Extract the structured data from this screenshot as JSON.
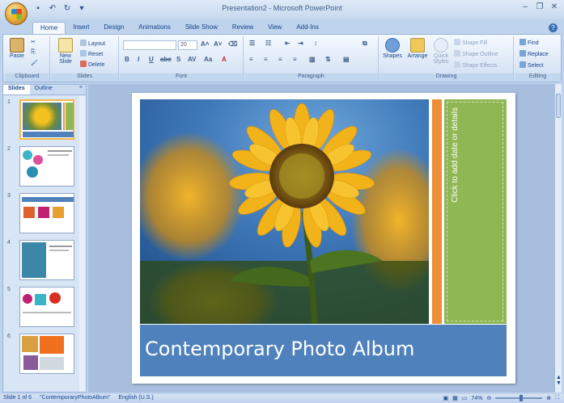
{
  "window": {
    "title": "Presentation2 - Microsoft PowerPoint"
  },
  "tabs": [
    "Home",
    "Insert",
    "Design",
    "Animations",
    "Slide Show",
    "Review",
    "View",
    "Add-Ins"
  ],
  "ribbon": {
    "clipboard": {
      "label": "Clipboard",
      "paste": "Paste"
    },
    "slides": {
      "label": "Slides",
      "new_slide": "New Slide",
      "layout": "Layout",
      "reset": "Reset",
      "delete": "Delete"
    },
    "font": {
      "label": "Font",
      "font_name": "",
      "font_size": "20"
    },
    "paragraph": {
      "label": "Paragraph"
    },
    "drawing": {
      "label": "Drawing",
      "shapes": "Shapes",
      "arrange": "Arrange",
      "quick_styles": "Quick Styles",
      "shape_fill": "Shape Fill",
      "shape_outline": "Shape Outline",
      "shape_effects": "Shape Effects"
    },
    "editing": {
      "label": "Editing",
      "find": "Find",
      "replace": "Replace",
      "select": "Select"
    }
  },
  "panel": {
    "tab_slides": "Slides",
    "tab_outline": "Outline",
    "close": "×"
  },
  "thumbnails": [
    {
      "num": "1",
      "selected": true
    },
    {
      "num": "2",
      "selected": false
    },
    {
      "num": "3",
      "selected": false
    },
    {
      "num": "4",
      "selected": false
    },
    {
      "num": "5",
      "selected": false
    },
    {
      "num": "6",
      "selected": false
    }
  ],
  "slide": {
    "title": "Contemporary Photo Album",
    "date_placeholder": "Click to add date or details"
  },
  "status": {
    "slide_info": "Slide 1 of 6",
    "theme": "\"ContemporaryPhotoAlbum\"",
    "language": "English (U.S.)",
    "zoom": "74%"
  },
  "colors": {
    "title_band": "#4f81bd",
    "orange_bar": "#ee8e38",
    "green_bar": "#8fb854"
  }
}
